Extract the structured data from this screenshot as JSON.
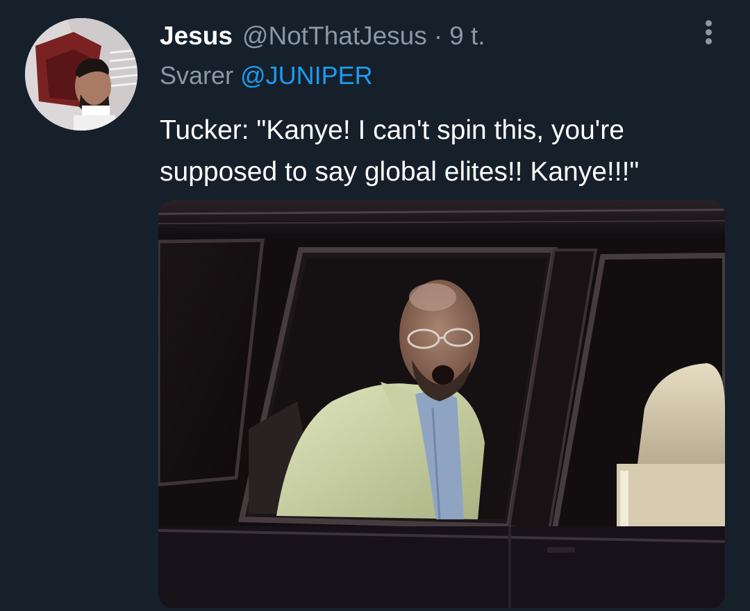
{
  "tweet": {
    "display_name": "Jesus",
    "handle": "@NotThatJesus",
    "separator": "·",
    "time": "9 t.",
    "reply_prefix": "Svarer",
    "reply_to": "@JUNIPER",
    "text": "Tucker: \"Kanye! I can't spin this, you're\nsupposed to say global elites!! Kanye!!!\""
  },
  "icons": {
    "more": "more-vertical-icon",
    "avatar": "user-avatar-photo",
    "media": "car-window-shouting-man-photo"
  },
  "colors": {
    "background": "#15202b",
    "text_primary": "#ffffff",
    "text_secondary": "#8b98a5",
    "link": "#1d9bf0"
  }
}
